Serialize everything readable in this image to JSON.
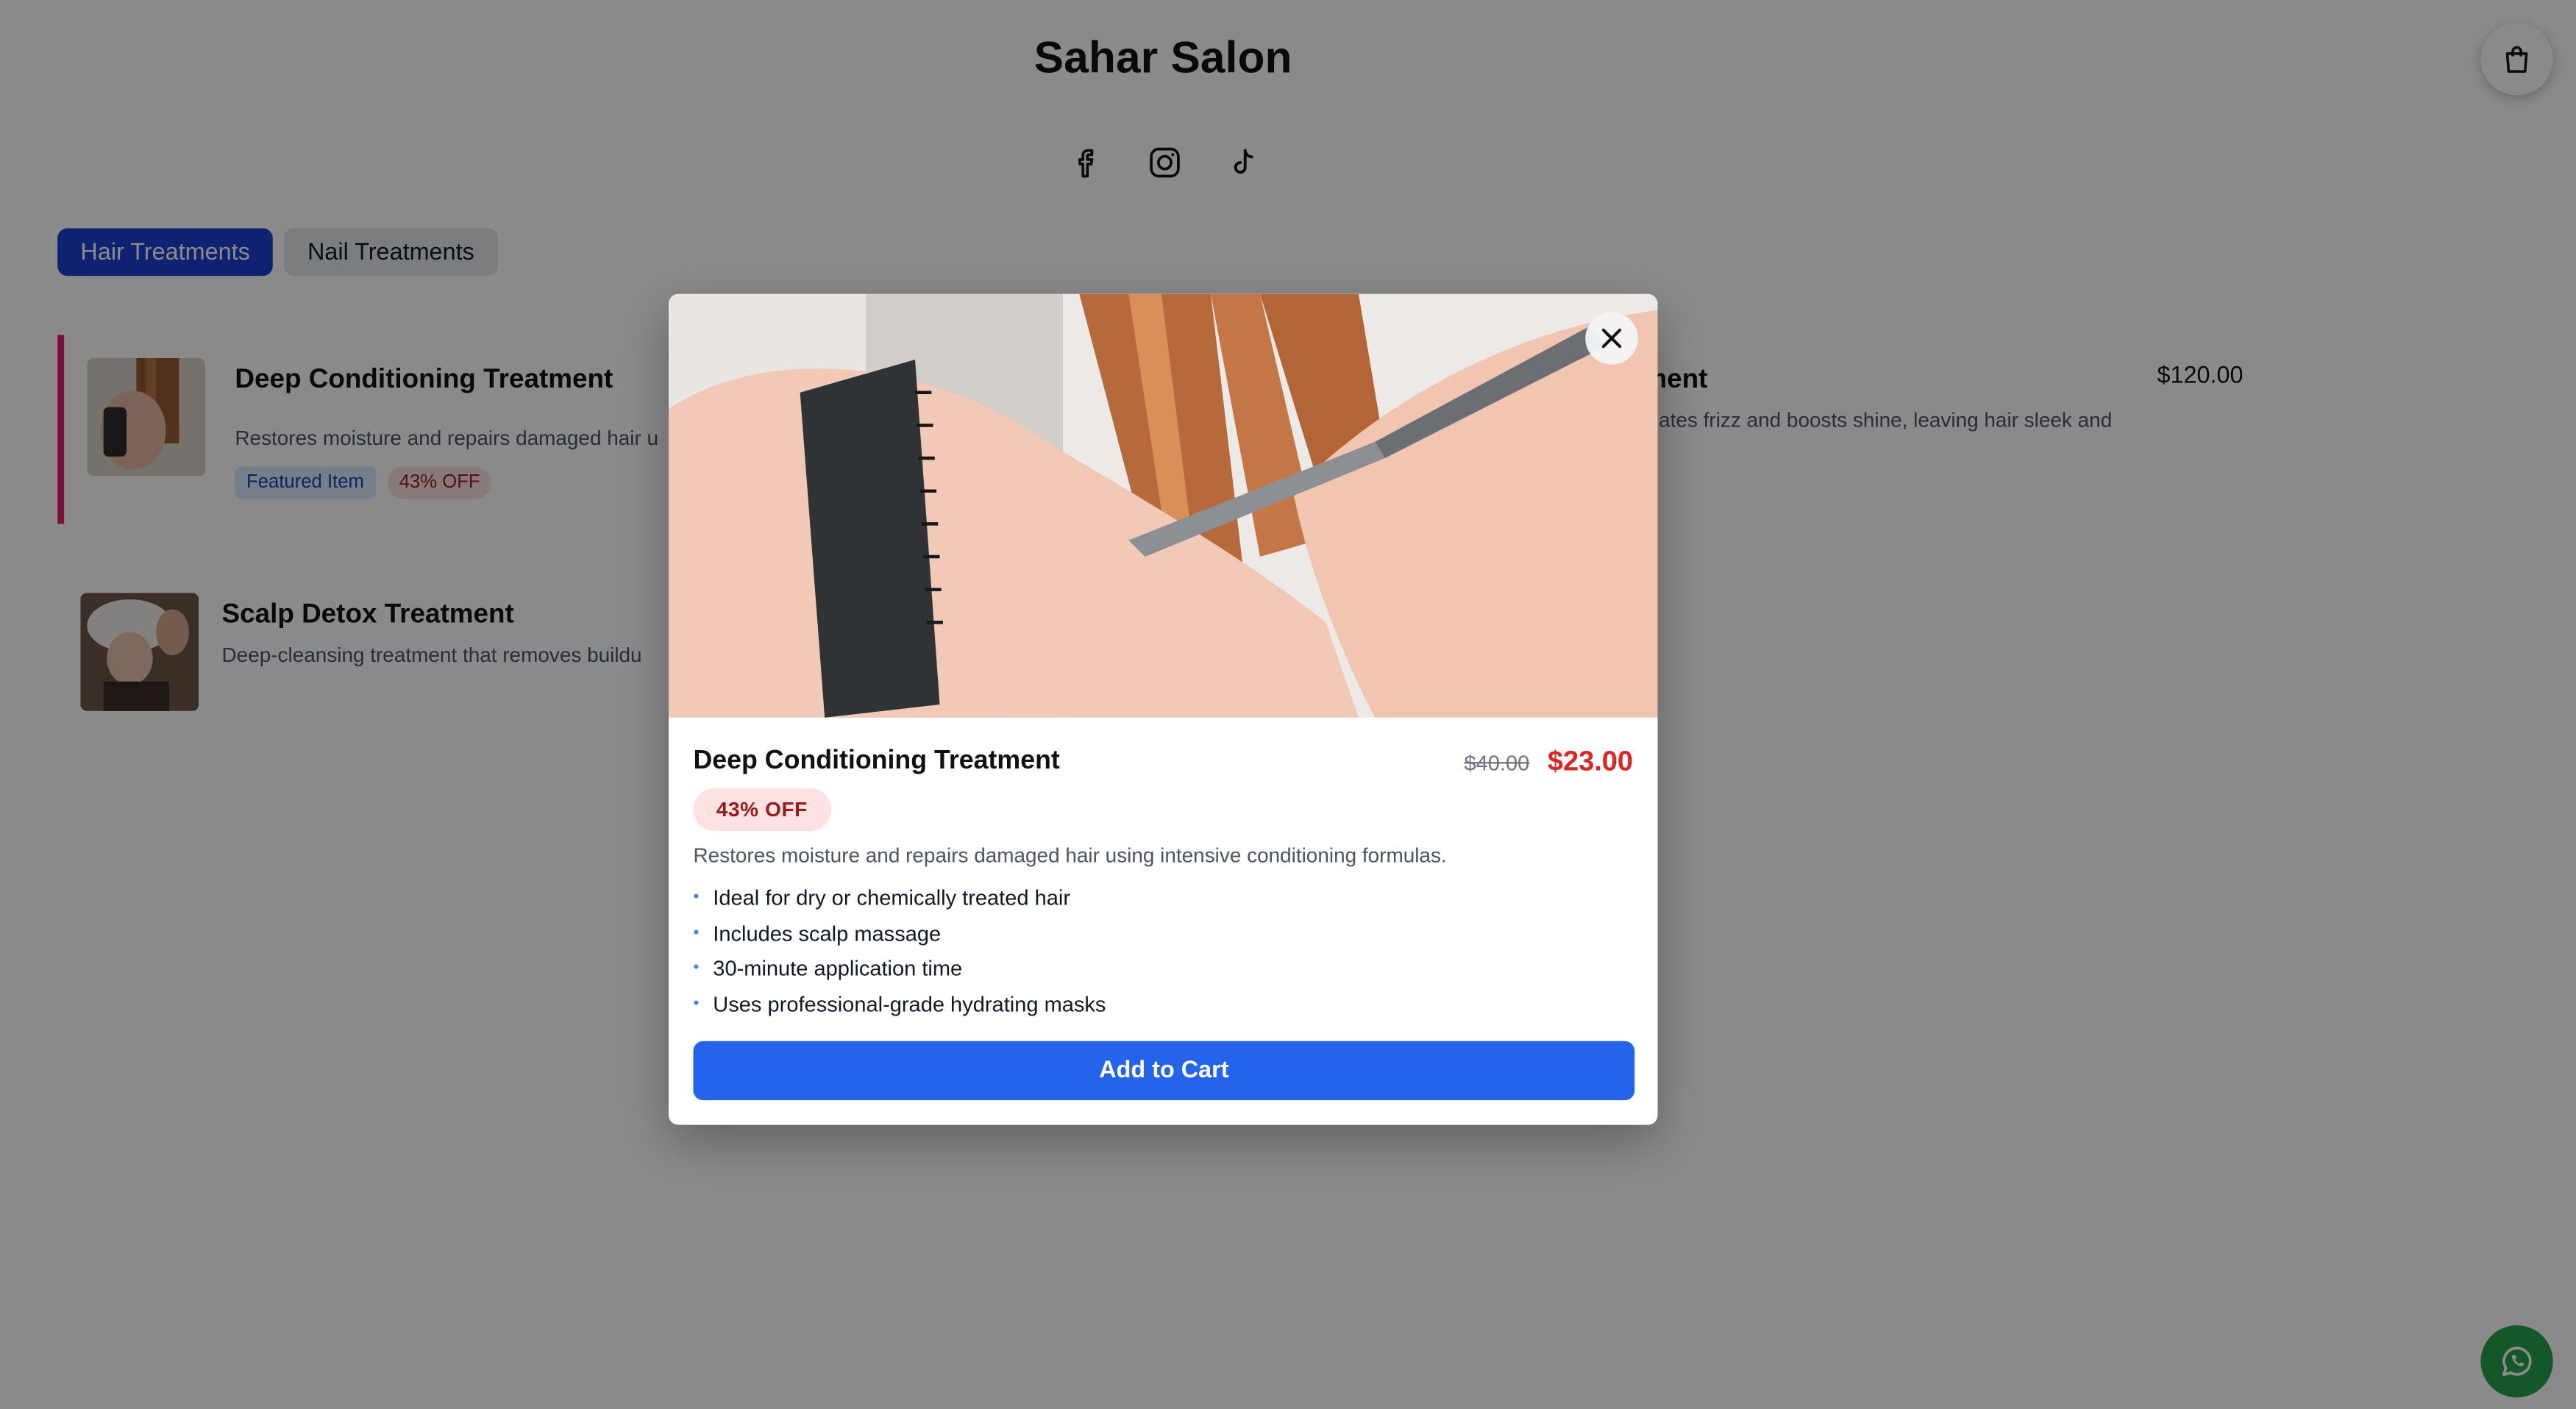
{
  "header": {
    "title": "Sahar Salon",
    "social_icons": [
      "facebook-icon",
      "instagram-icon",
      "tiktok-icon"
    ],
    "cart_icon": "shopping-bag-icon"
  },
  "tabs": [
    {
      "label": "Hair Treatments",
      "active": true
    },
    {
      "label": "Nail Treatments",
      "active": false
    }
  ],
  "menu": {
    "items": [
      {
        "name": "Deep Conditioning Treatment",
        "description": "Restores moisture and repairs damaged hair u",
        "badge_featured": "Featured Item",
        "badge_discount": "43% OFF",
        "highlight_color": "#e11d74"
      },
      {
        "name": "Scalp Detox Treatment",
        "description": "Deep-cleansing treatment that removes buildu"
      },
      {
        "name": "ment",
        "description": "inates frizz and boosts shine, leaving hair sleek and",
        "price": "$120.00"
      }
    ]
  },
  "modal": {
    "name": "Deep Conditioning Treatment",
    "old_price": "$40.00",
    "new_price": "$23.00",
    "discount": "43% OFF",
    "description": "Restores moisture and repairs damaged hair using intensive conditioning formulas.",
    "features": [
      "Ideal for dry or chemically treated hair",
      "Includes scalp massage",
      "30-minute application time",
      "Uses professional-grade hydrating masks"
    ],
    "add_to_cart": "Add to Cart",
    "close_icon": "close-icon"
  },
  "colors": {
    "primary": "#2563eb",
    "tab_active": "#1d3fd1",
    "sale_price": "#dc2626",
    "whatsapp": "#25a34f"
  },
  "floating": {
    "whatsapp_icon": "whatsapp-icon"
  }
}
